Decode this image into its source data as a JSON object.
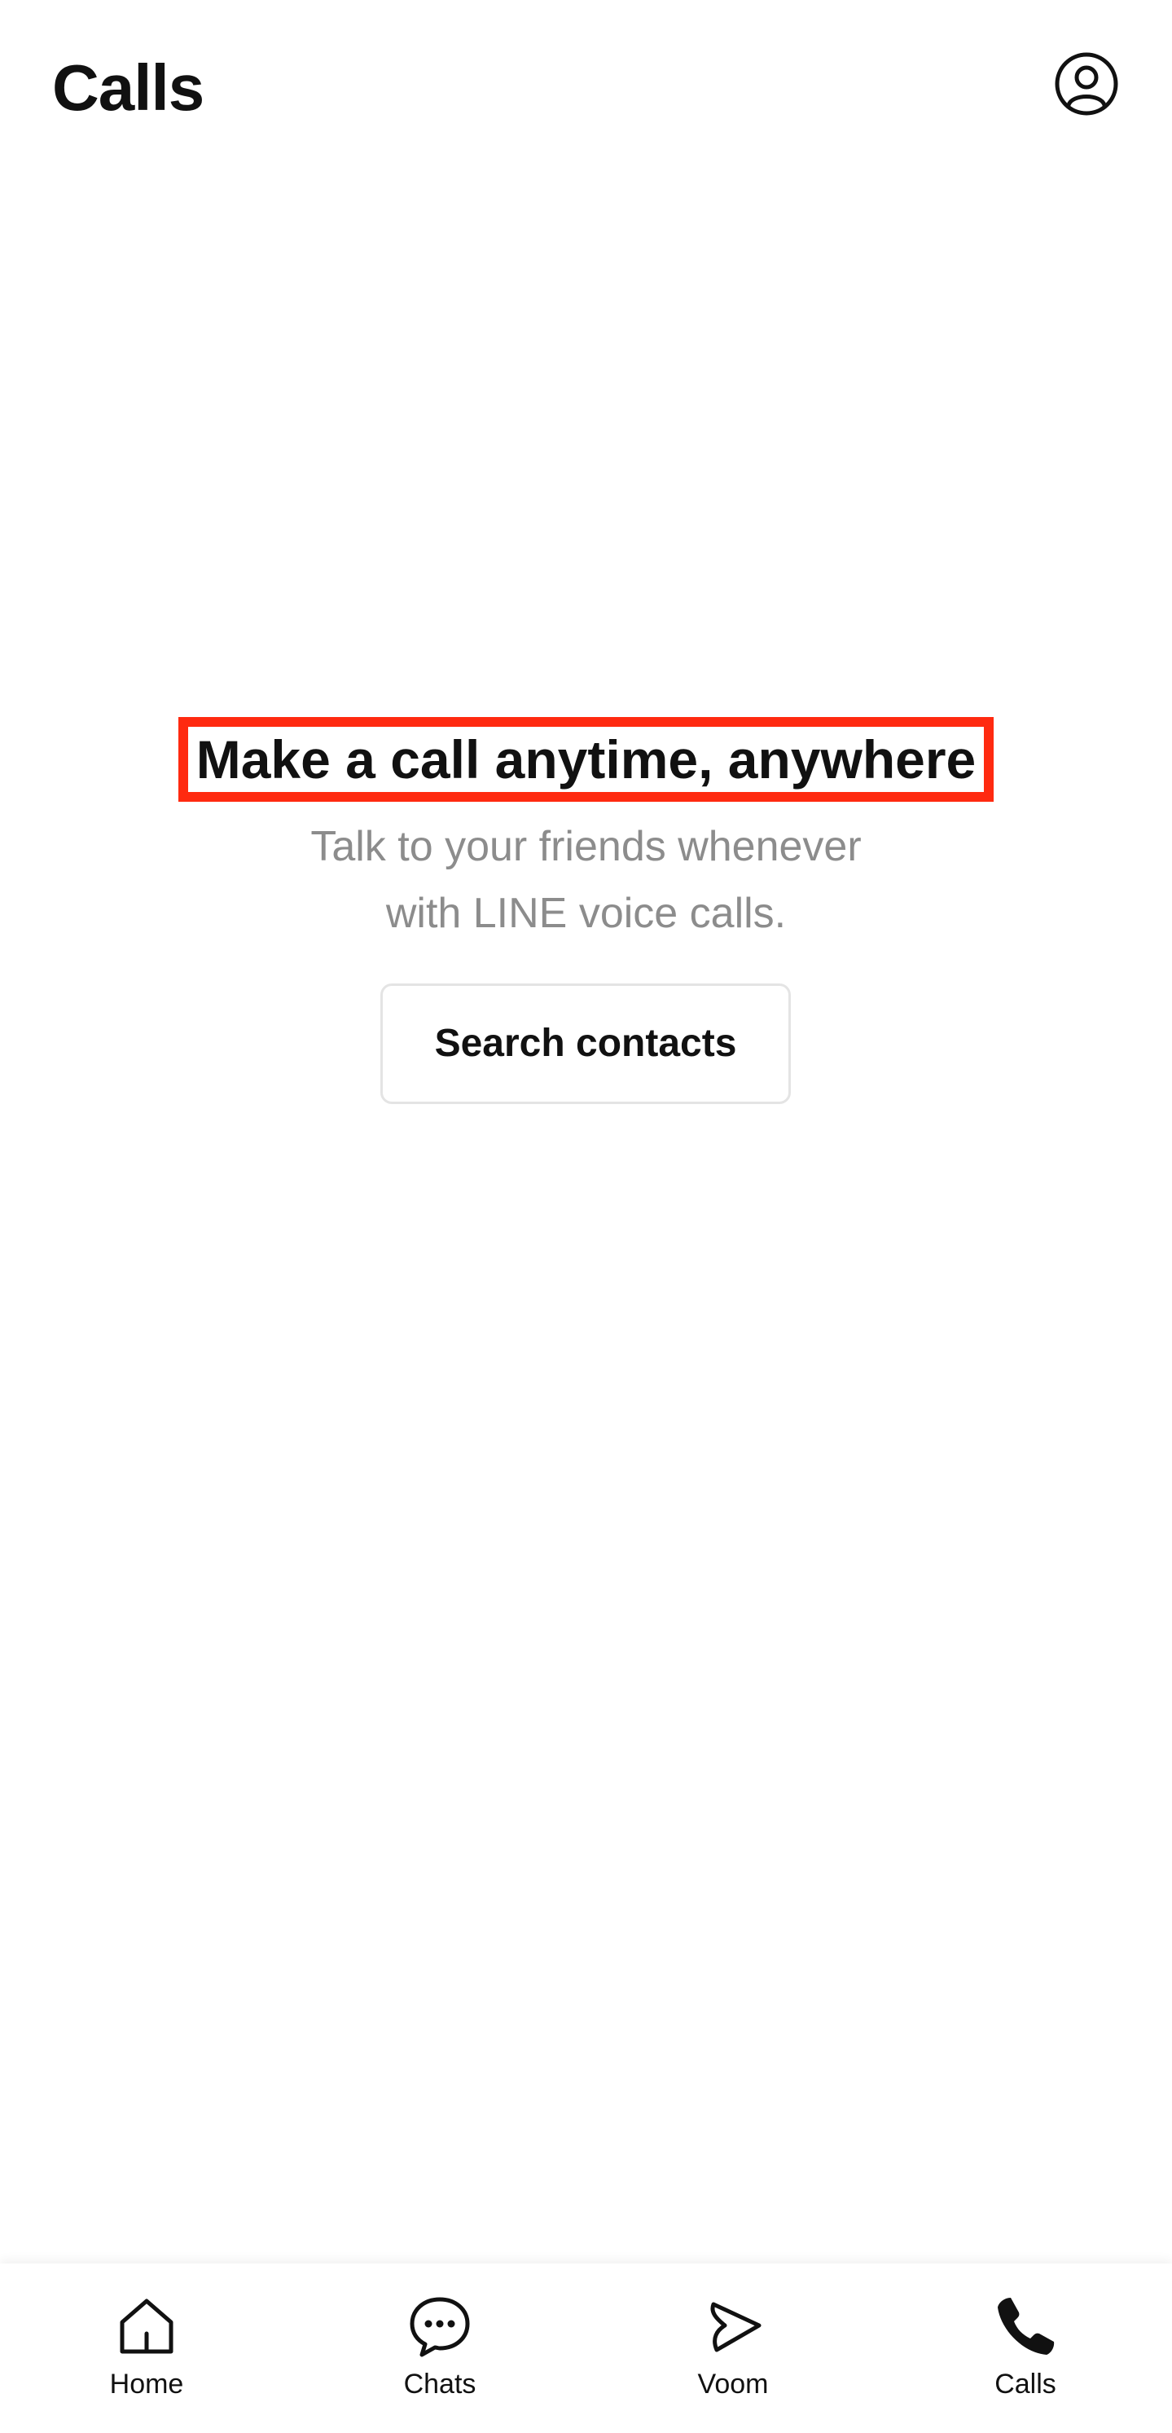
{
  "header": {
    "title": "Calls",
    "profile_icon": "profile-icon"
  },
  "empty_state": {
    "headline": "Make a call anytime, anywhere",
    "subtitle_line1": "Talk to your friends whenever",
    "subtitle_line2": "with LINE voice calls.",
    "search_button_label": "Search contacts",
    "highlight_color": "#ff2a10"
  },
  "tabbar": {
    "tabs": [
      {
        "label": "Home",
        "icon": "home-icon",
        "active": false
      },
      {
        "label": "Chats",
        "icon": "chat-icon",
        "active": false
      },
      {
        "label": "Voom",
        "icon": "voom-icon",
        "active": false
      },
      {
        "label": "Calls",
        "icon": "phone-icon",
        "active": true
      }
    ]
  }
}
